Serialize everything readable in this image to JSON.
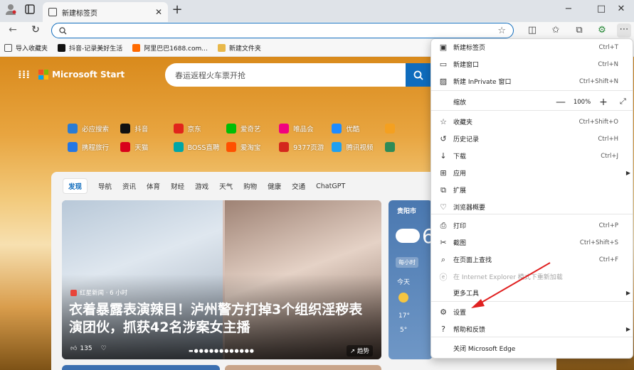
{
  "tabbar": {
    "tab_title": "新建标签页",
    "close_glyph": "✕",
    "new_tab_glyph": "+"
  },
  "window": {
    "minimize": "−",
    "maximize": "□",
    "close": "✕"
  },
  "address": {
    "value": "",
    "placeholder": ""
  },
  "favorites": [
    {
      "label": "导入收藏夹",
      "color": "#555555"
    },
    {
      "label": "抖音-记录美好生活",
      "color": "#111111"
    },
    {
      "label": "阿里巴巴1688.com...",
      "color": "#ff6a00"
    },
    {
      "label": "新建文件夹",
      "color": "#e8b84a"
    }
  ],
  "brand": {
    "name": "Microsoft Start",
    "grid_glyph": "⋮⋮⋮"
  },
  "search": {
    "placeholder": "春运返程火车票开抢"
  },
  "quick_links": {
    "row1": [
      {
        "label": "必应搜索",
        "color": "#2b7cd3"
      },
      {
        "label": "抖音",
        "color": "#111111"
      },
      {
        "label": "京东",
        "color": "#e1251b"
      },
      {
        "label": "爱奇艺",
        "color": "#00be06"
      },
      {
        "label": "唯品会",
        "color": "#f10180"
      },
      {
        "label": "优酷",
        "color": "#1f8cff"
      },
      {
        "label": "",
        "color": "#f4a020"
      }
    ],
    "row2": [
      {
        "label": "携程旅行",
        "color": "#2577e3"
      },
      {
        "label": "天猫",
        "color": "#d9001b"
      },
      {
        "label": "BOSS直聘",
        "color": "#00a6a7"
      },
      {
        "label": "爱淘宝",
        "color": "#ff5000"
      },
      {
        "label": "9377页游",
        "color": "#d4271d"
      },
      {
        "label": "腾讯视频",
        "color": "#20a0f0"
      },
      {
        "label": "",
        "color": "#2e8b57"
      }
    ]
  },
  "feed": {
    "tabs": [
      "发现",
      "导航",
      "资讯",
      "体育",
      "财经",
      "游戏",
      "天气",
      "购物",
      "健康",
      "交通",
      "ChatGPT"
    ],
    "hero": {
      "source": "红星新闻 · 6 小时",
      "title": "衣着暴露表演辣目！泸州警方打掉3个组织淫秽表演团伙，抓获42名涉案女主播",
      "likes": "135",
      "trend": "趋势"
    },
    "weather": {
      "city": "贵阳市",
      "temp": "6",
      "hourly": "每小时",
      "today": "今天",
      "high": "17°",
      "low": "5°"
    }
  },
  "menu": {
    "items": [
      {
        "icon": "▣",
        "label": "新建标签页",
        "shortcut": "Ctrl+T"
      },
      {
        "icon": "▭",
        "label": "新建窗口",
        "shortcut": "Ctrl+N"
      },
      {
        "icon": "▨",
        "label": "新建 InPrivate 窗口",
        "shortcut": "Ctrl+Shift+N"
      },
      {
        "label": "缩放",
        "value": "100%"
      },
      {
        "icon": "☆",
        "label": "收藏夹",
        "shortcut": "Ctrl+Shift+O"
      },
      {
        "icon": "↺",
        "label": "历史记录",
        "shortcut": "Ctrl+H"
      },
      {
        "icon": "↓",
        "label": "下载",
        "shortcut": "Ctrl+J"
      },
      {
        "icon": "⊞",
        "label": "应用",
        "shortcut": ""
      },
      {
        "icon": "⧉",
        "label": "扩展",
        "shortcut": ""
      },
      {
        "icon": "♡",
        "label": "浏览器概要",
        "shortcut": ""
      },
      {
        "icon": "⎙",
        "label": "打印",
        "shortcut": "Ctrl+P"
      },
      {
        "icon": "✂",
        "label": "截图",
        "shortcut": "Ctrl+Shift+S"
      },
      {
        "icon": "⌕",
        "label": "在页面上查找",
        "shortcut": "Ctrl+F"
      },
      {
        "icon": "ⓔ",
        "label": "在 Internet Explorer 模式下重新加载",
        "shortcut": ""
      },
      {
        "icon": "",
        "label": "更多工具",
        "shortcut": ""
      },
      {
        "icon": "⚙",
        "label": "设置",
        "shortcut": ""
      },
      {
        "icon": "?",
        "label": "帮助和反馈",
        "shortcut": ""
      },
      {
        "icon": "",
        "label": "关闭 Microsoft Edge",
        "shortcut": ""
      }
    ],
    "submenu_arrow": "▶",
    "zoom_minus": "—",
    "zoom_plus": "+",
    "zoom_full": "⤢"
  },
  "annotation": {
    "color": "#e02020"
  }
}
